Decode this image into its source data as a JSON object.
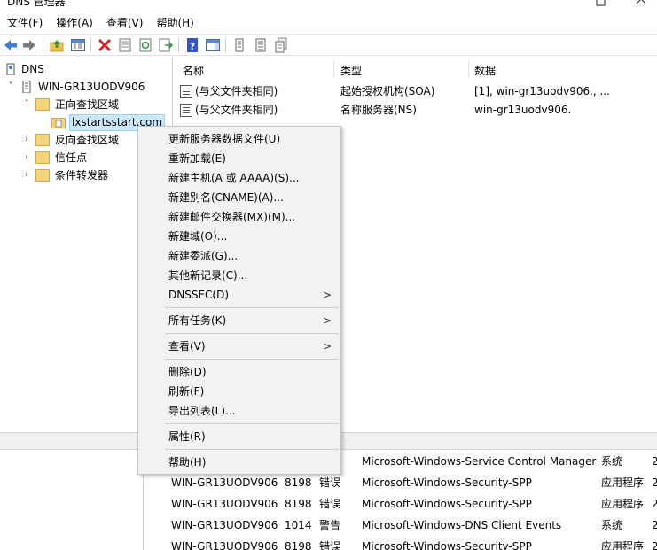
{
  "window": {
    "title": "DNS 管理器",
    "min_icon": "minimize-icon",
    "close_icon": "close-icon"
  },
  "menubar": [
    "文件(F)",
    "操作(A)",
    "查看(V)",
    "帮助(H)"
  ],
  "toolbar": {
    "icons": [
      "back-arrow-icon",
      "forward-arrow-icon",
      "up-folder-icon",
      "show-hide-tree-icon",
      "delete-icon",
      "properties-icon",
      "refresh-icon",
      "export-list-icon",
      "help-icon",
      "action-pane-icon",
      "host-record-icon",
      "server-icon",
      "zone-icon"
    ],
    "colors": {
      "arrow": "#3a7bd5",
      "delete": "#d42020",
      "help": "#3355cc"
    }
  },
  "tree": {
    "root": "DNS",
    "server": "WIN-GR13UODV906",
    "forward_zones": "正向查找区域",
    "selected_zone": "lxstartsstart.com",
    "reverse_zones": "反向查找区域",
    "trust_points": "信任点",
    "conditional_forwarders": "条件转发器"
  },
  "list": {
    "columns": [
      "名称",
      "类型",
      "数据"
    ],
    "rows": [
      {
        "name": "(与父文件夹相同)",
        "type": "起始授权机构(SOA)",
        "data": "[1], win-gr13uodv906., ..."
      },
      {
        "name": "(与父文件夹相同)",
        "type": "名称服务器(NS)",
        "data": "win-gr13uodv906."
      }
    ]
  },
  "context_menu": {
    "items": [
      {
        "label": "更新服务器数据文件(U)"
      },
      {
        "label": "重新加载(E)"
      },
      {
        "label": "新建主机(A 或 AAAA)(S)..."
      },
      {
        "label": "新建别名(CNAME)(A)..."
      },
      {
        "label": "新建邮件交换器(MX)(M)..."
      },
      {
        "label": "新建域(O)..."
      },
      {
        "label": "新建委派(G)..."
      },
      {
        "label": "其他新记录(C)..."
      },
      {
        "label": "DNSSEC(D)",
        "submenu": true
      },
      {
        "label": "所有任务(K)",
        "submenu": true
      },
      {
        "label": "查看(V)",
        "submenu": true
      },
      {
        "label": "删除(D)"
      },
      {
        "label": "刷新(F)"
      },
      {
        "label": "导出列表(L)..."
      },
      {
        "label": "属性(R)"
      },
      {
        "label": "帮助(H)"
      }
    ],
    "submenu_arrow": ">"
  },
  "log": {
    "rows": [
      {
        "computer": "",
        "id": "",
        "level": "",
        "source": "Microsoft-Windows-Service Control Manager",
        "category": "系统",
        "tail": "2"
      },
      {
        "computer": "WIN-GR13UODV906",
        "id": "8198",
        "level": "错误",
        "source": "Microsoft-Windows-Security-SPP",
        "category": "应用程序",
        "tail": "2"
      },
      {
        "computer": "WIN-GR13UODV906",
        "id": "8198",
        "level": "错误",
        "source": "Microsoft-Windows-Security-SPP",
        "category": "应用程序",
        "tail": "2"
      },
      {
        "computer": "WIN-GR13UODV906",
        "id": "1014",
        "level": "警告",
        "source": "Microsoft-Windows-DNS Client Events",
        "category": "系统",
        "tail": "2"
      },
      {
        "computer": "WIN-GR13UODV906",
        "id": "8198",
        "level": "错误",
        "source": "Microsoft-Windows-Security-SPP",
        "category": "应用程序",
        "tail": "2"
      }
    ]
  }
}
